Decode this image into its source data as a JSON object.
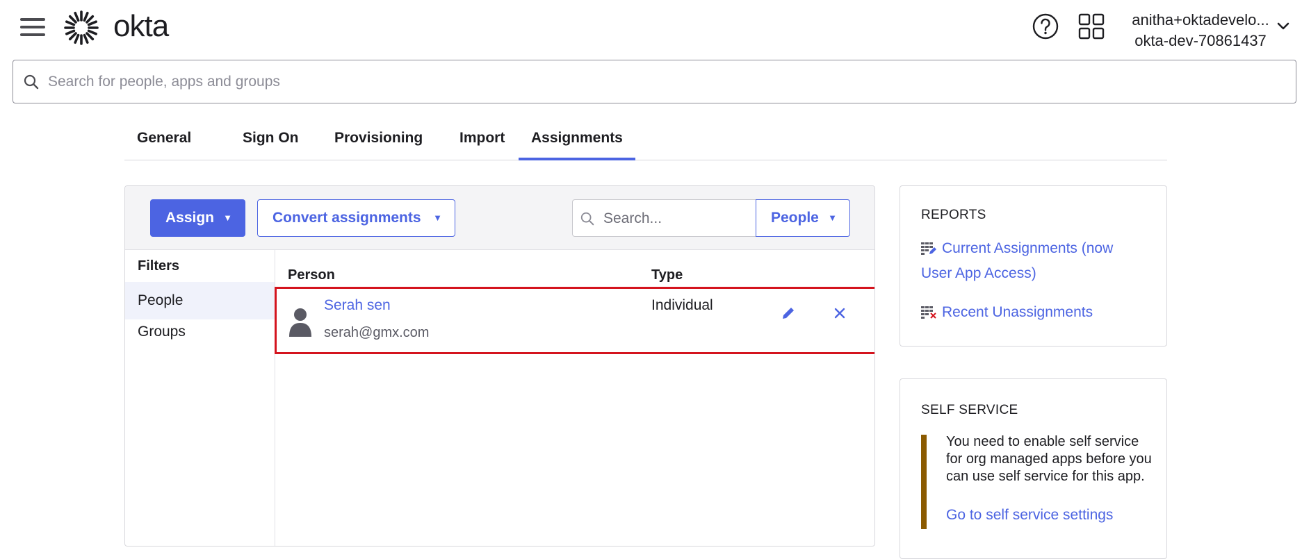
{
  "header": {
    "brand": "okta",
    "user_name": "anitha+oktadevelo...",
    "org_name": "okta-dev-70861437"
  },
  "search": {
    "placeholder": "Search for people, apps and groups"
  },
  "tabs": [
    {
      "label": "General",
      "active": false
    },
    {
      "label": "Sign On",
      "active": false
    },
    {
      "label": "Provisioning",
      "active": false
    },
    {
      "label": "Import",
      "active": false
    },
    {
      "label": "Assignments",
      "active": true
    }
  ],
  "toolbar": {
    "assign_label": "Assign",
    "convert_label": "Convert assignments",
    "search_placeholder": "Search...",
    "filter_label": "People",
    "caret": "▼"
  },
  "filters": {
    "title": "Filters",
    "items": [
      {
        "label": "People",
        "active": true
      },
      {
        "label": "Groups",
        "active": false
      }
    ]
  },
  "table": {
    "columns": [
      "Person",
      "Type"
    ],
    "rows": [
      {
        "name": "Serah sen",
        "email": "serah@gmx.com",
        "type": "Individual"
      }
    ]
  },
  "reports": {
    "title": "REPORTS",
    "current_line1": "Current Assignments (now",
    "current_line2": "User App Access)",
    "recent": "Recent Unassignments"
  },
  "self_service": {
    "title": "SELF SERVICE",
    "notice": "You need to enable self service for org managed apps before you can use self service for this app.",
    "link": "Go to self service settings"
  },
  "colors": {
    "accent": "#4c64e2",
    "highlight": "#d4141e",
    "warning_bar": "#8b5a00"
  }
}
